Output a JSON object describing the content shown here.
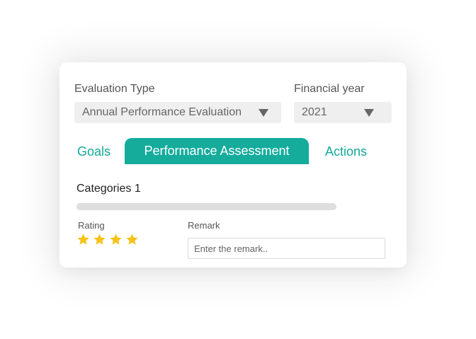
{
  "evaluation_type": {
    "label": "Evaluation Type",
    "selected": "Annual Performance Evaluation"
  },
  "financial_year": {
    "label": "Financial year",
    "selected": "2021"
  },
  "tabs": [
    {
      "label": "Goals",
      "active": false
    },
    {
      "label": "Performance Assessment",
      "active": true
    },
    {
      "label": "Actions",
      "active": false
    }
  ],
  "category": {
    "title": "Categories 1"
  },
  "rating": {
    "label": "Rating",
    "stars": 4,
    "star_color": "#f7c21b"
  },
  "remark": {
    "label": "Remark",
    "placeholder": "Enter the remark.."
  },
  "colors": {
    "accent": "#15ac9c"
  }
}
